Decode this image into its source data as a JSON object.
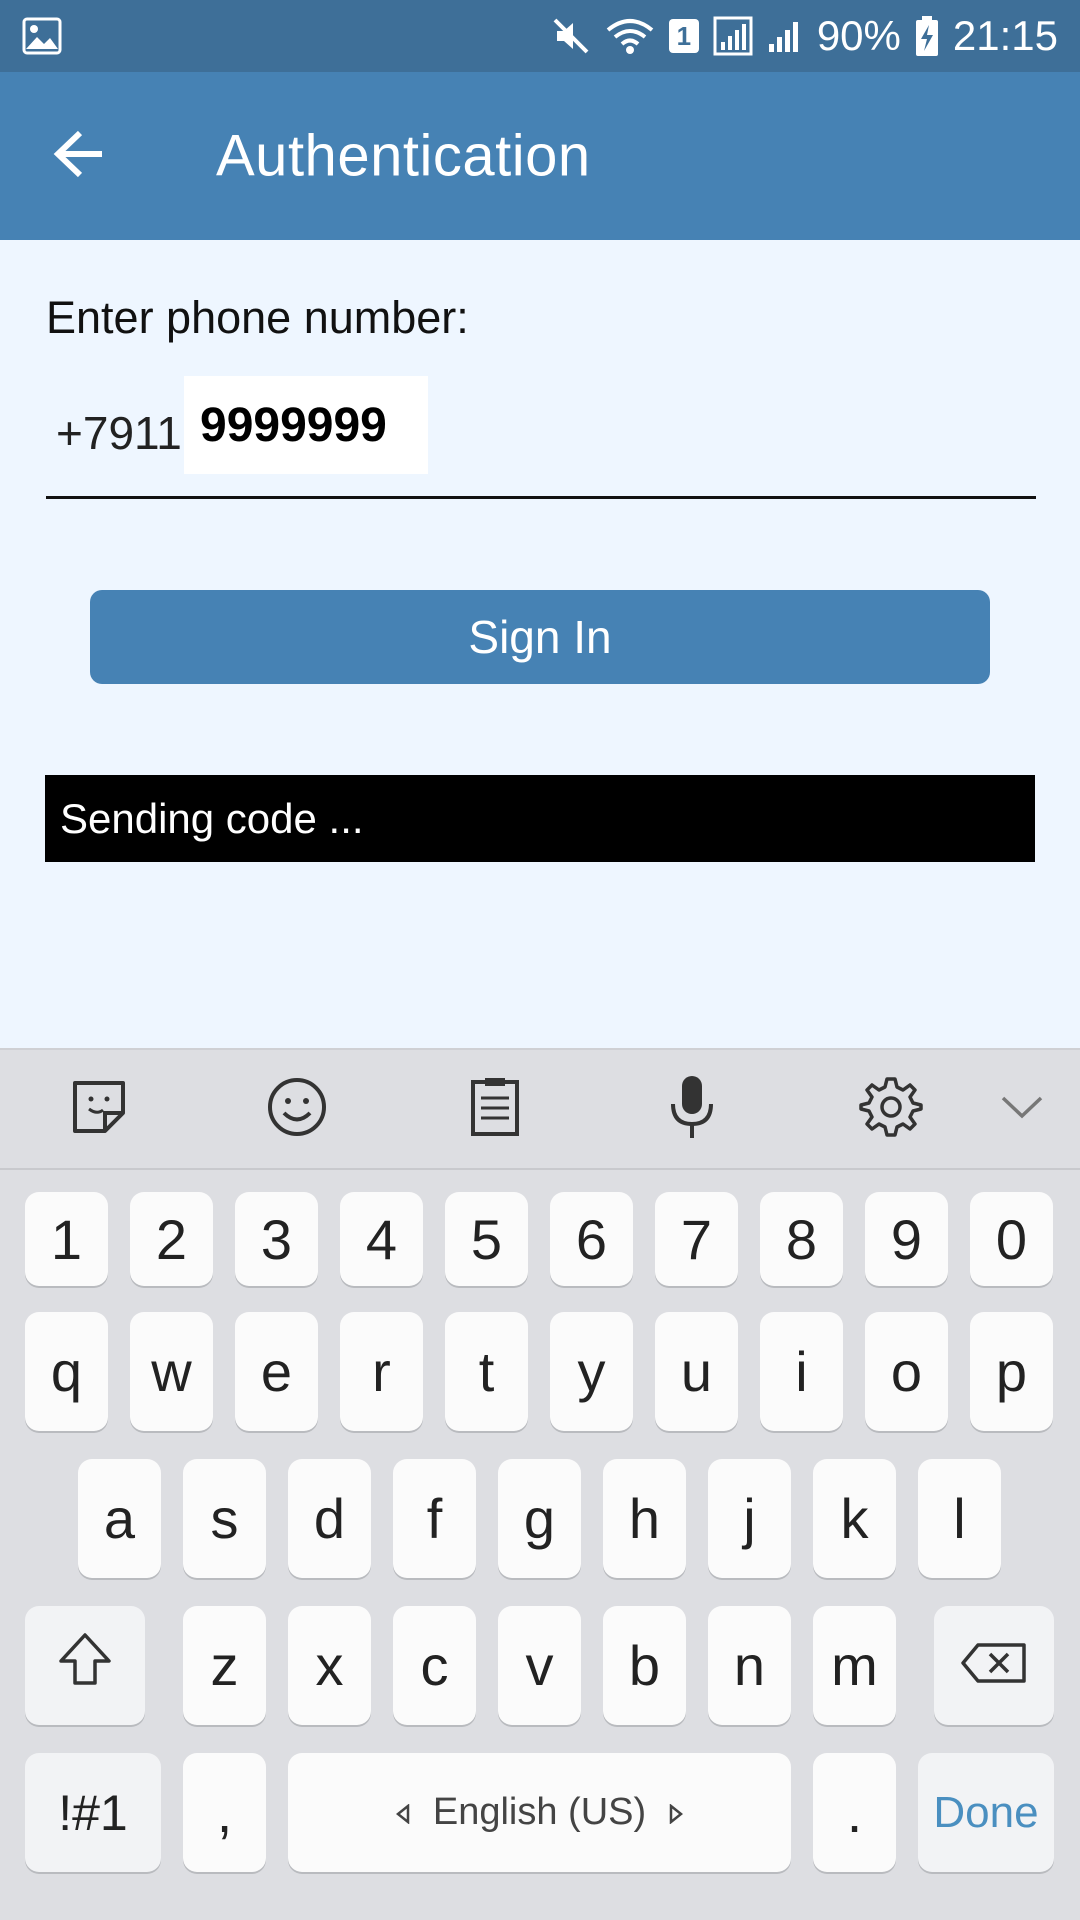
{
  "status_bar": {
    "battery_percent": "90%",
    "time": "21:15",
    "sim_badge": "1",
    "icons": [
      "gallery-icon",
      "mute-icon",
      "wifi-icon",
      "signal-icon",
      "signal-icon",
      "battery-charging-icon"
    ]
  },
  "app_bar": {
    "title": "Authentication",
    "back_icon": "arrow-left-icon",
    "background": "#4682b4"
  },
  "form": {
    "label": "Enter phone number:",
    "prefix": "+7911",
    "phone_value": "9999999",
    "sign_in_label": "Sign In",
    "status_text": "Sending code ..."
  },
  "keyboard": {
    "toolbar": [
      "sticker-icon",
      "emoji-icon",
      "clipboard-icon",
      "microphone-icon",
      "settings-icon",
      "chevron-down-icon"
    ],
    "row_numbers": [
      "1",
      "2",
      "3",
      "4",
      "5",
      "6",
      "7",
      "8",
      "9",
      "0"
    ],
    "row_1": [
      "q",
      "w",
      "e",
      "r",
      "t",
      "y",
      "u",
      "i",
      "o",
      "p"
    ],
    "row_2": [
      "a",
      "s",
      "d",
      "f",
      "g",
      "h",
      "j",
      "k",
      "l"
    ],
    "row_3": [
      "z",
      "x",
      "c",
      "v",
      "b",
      "n",
      "m"
    ],
    "symbols_label": "!#1",
    "comma_label": ",",
    "space_label": "English (US)",
    "period_label": ".",
    "done_label": "Done",
    "accent": "#4a8fc0"
  }
}
